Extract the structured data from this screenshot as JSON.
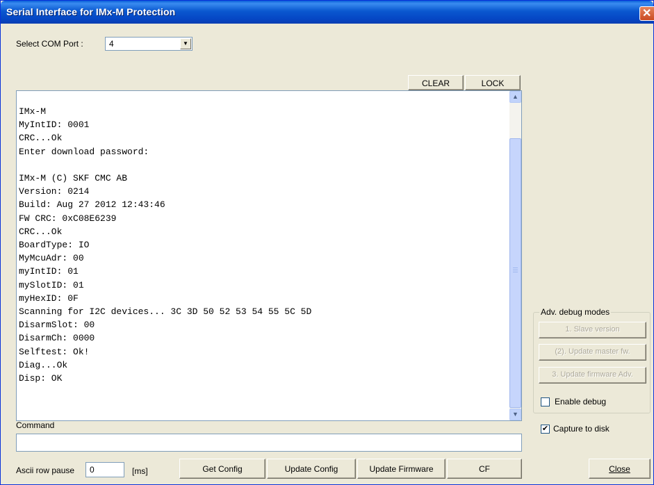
{
  "window": {
    "title": "Serial Interface for IMx-M Protection",
    "close_glyph": "✕"
  },
  "com_port": {
    "label": "Select COM Port :",
    "value": "4"
  },
  "console_toolbar": {
    "clear_label": "CLEAR",
    "lock_label": "LOCK"
  },
  "console": {
    "text": "IMx-M\nMyIntID: 0001\nCRC...Ok\nEnter download password:\n\nIMx-M (C) SKF CMC AB\nVersion: 0214\nBuild: Aug 27 2012 12:43:46\nFW CRC: 0xC08E6239\nCRC...Ok\nBoardType: IO\nMyMcuAdr: 00\nmyIntID: 01\nmySlotID: 01\nmyHexID: 0F\nScanning for I2C devices... 3C 3D 50 52 53 54 55 5C 5D\nDisarmSlot: 00\nDisarmCh: 0000\nSelftest: Ok!\nDiag...Ok\nDisp: OK"
  },
  "command": {
    "label": "Command",
    "value": ""
  },
  "ascii": {
    "label": "Ascii row pause",
    "value": "0",
    "unit": "[ms]"
  },
  "buttons": {
    "get_config": "Get Config",
    "update_config": "Update Config",
    "update_firmware": "Update Firmware",
    "cf": "CF",
    "close": "Close"
  },
  "adv_debug": {
    "title": "Adv. debug modes",
    "slave_version": "1. Slave version",
    "update_master": "(2). Update master fw.",
    "update_firmware_adv": "3. Update firmware Adv.",
    "enable_debug": {
      "label": "Enable debug",
      "checked": false
    }
  },
  "capture": {
    "label": "Capture to disk",
    "checked": true
  },
  "icons": {
    "up_arrow": "▲",
    "down_arrow": "▼",
    "check": "✔"
  },
  "colors": {
    "titlebar": "#0a58d0",
    "dialog_bg": "#ece9d8",
    "scrollbar": "#c6d5fc"
  }
}
